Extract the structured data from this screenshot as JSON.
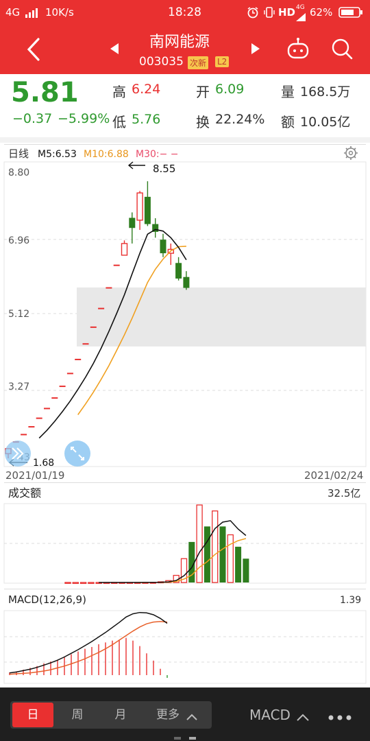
{
  "status": {
    "network": "4G",
    "speed": "10K/s",
    "time": "18:28",
    "hd": "HD",
    "sim_tag": "4G",
    "battery": "62%"
  },
  "header": {
    "stock_name": "南网能源",
    "stock_code": "003035",
    "badge_new": "次新",
    "badge_l2": "L2"
  },
  "quote": {
    "price": "5.81",
    "change": "−0.37",
    "change_pct": "−5.99%",
    "high_label": "高",
    "high": "6.24",
    "low_label": "低",
    "low": "5.76",
    "open_label": "开",
    "open": "6.09",
    "turnover_label": "换",
    "turnover": "22.24%",
    "volume_label": "量",
    "volume": "168.5万",
    "amount_label": "额",
    "amount": "10.05亿"
  },
  "kline": {
    "period": "日线",
    "ma5": "M5:6.53",
    "ma10": "M10:6.88",
    "ma30": "M30:− −",
    "y_ticks": [
      "8.80",
      "6.96",
      "5.12",
      "3.27"
    ],
    "y_bottom": "43",
    "high_mark": "8.55",
    "low_mark": "1.68",
    "date_start": "2021/01/19",
    "date_end": "2021/02/24"
  },
  "volume_panel": {
    "title": "成交额",
    "max": "32.5亿"
  },
  "macd_panel": {
    "title": "MACD(12,26,9)",
    "max": "1.39"
  },
  "bottom": {
    "tabs": [
      "日",
      "周",
      "月",
      "更多"
    ],
    "indicator": "MACD"
  },
  "colors": {
    "up": "#e93030",
    "down": "#2e7d1e",
    "ma10": "#f0a020",
    "ma5": "#111111"
  },
  "chart_data": {
    "type": "candlestick",
    "x_range": [
      "2021/01/19",
      "2021/02/24"
    ],
    "ylim": [
      1.43,
      8.8
    ],
    "highest": 8.55,
    "lowest": 1.68,
    "candles": [
      {
        "o": 1.55,
        "c": 1.68,
        "h": 1.68,
        "l": 1.43
      },
      {
        "o": 1.85,
        "c": 1.85,
        "h": 1.85,
        "l": 1.85
      },
      {
        "o": 2.04,
        "c": 2.04,
        "h": 2.04,
        "l": 2.04
      },
      {
        "o": 2.24,
        "c": 2.24,
        "h": 2.24,
        "l": 2.24
      },
      {
        "o": 2.46,
        "c": 2.46,
        "h": 2.46,
        "l": 2.46
      },
      {
        "o": 2.71,
        "c": 2.71,
        "h": 2.71,
        "l": 2.71
      },
      {
        "o": 2.98,
        "c": 2.98,
        "h": 2.98,
        "l": 2.98
      },
      {
        "o": 3.28,
        "c": 3.28,
        "h": 3.28,
        "l": 3.28
      },
      {
        "o": 3.61,
        "c": 3.61,
        "h": 3.61,
        "l": 3.61
      },
      {
        "o": 3.97,
        "c": 3.97,
        "h": 3.97,
        "l": 3.97
      },
      {
        "o": 4.37,
        "c": 4.37,
        "h": 4.37,
        "l": 4.37
      },
      {
        "o": 4.8,
        "c": 4.8,
        "h": 4.8,
        "l": 4.8
      },
      {
        "o": 5.28,
        "c": 5.28,
        "h": 5.28,
        "l": 5.28
      },
      {
        "o": 5.81,
        "c": 5.81,
        "h": 5.81,
        "l": 5.81
      },
      {
        "o": 6.39,
        "c": 6.39,
        "h": 6.39,
        "l": 6.39
      },
      {
        "o": 6.65,
        "c": 6.95,
        "h": 7.03,
        "l": 6.65
      },
      {
        "o": 7.61,
        "c": 7.35,
        "h": 7.75,
        "l": 6.95
      },
      {
        "o": 7.55,
        "c": 8.25,
        "h": 8.3,
        "l": 7.3
      },
      {
        "o": 8.15,
        "c": 7.45,
        "h": 8.55,
        "l": 7.4
      },
      {
        "o": 7.45,
        "c": 7.25,
        "h": 7.6,
        "l": 7.1
      },
      {
        "o": 7.05,
        "c": 6.7,
        "h": 7.2,
        "l": 6.6
      },
      {
        "o": 6.7,
        "c": 6.8,
        "h": 6.95,
        "l": 6.4
      },
      {
        "o": 6.45,
        "c": 6.05,
        "h": 6.6,
        "l": 6.0
      },
      {
        "o": 6.09,
        "c": 5.81,
        "h": 6.24,
        "l": 5.76
      }
    ],
    "ma5": [
      null,
      null,
      null,
      null,
      1.95,
      2.15,
      2.38,
      2.63,
      2.9,
      3.2,
      3.52,
      3.87,
      4.26,
      4.69,
      5.15,
      5.63,
      6.17,
      6.7,
      7.19,
      7.31,
      7.27,
      7.1,
      6.85,
      6.53
    ],
    "ma10": [
      null,
      null,
      null,
      null,
      null,
      null,
      null,
      null,
      null,
      2.55,
      2.83,
      3.13,
      3.46,
      3.81,
      4.2,
      4.6,
      5.03,
      5.49,
      5.95,
      6.29,
      6.55,
      6.76,
      6.87,
      6.88
    ],
    "amount": [
      0.05,
      0.03,
      0.03,
      0.03,
      0.03,
      0.03,
      0.04,
      0.04,
      0.04,
      0.05,
      0.06,
      0.1,
      0.3,
      0.8,
      3.0,
      10.0,
      17.0,
      32.5,
      23.5,
      30.0,
      23.5,
      20.0,
      15.0,
      10.0
    ],
    "amount_up": [
      true,
      true,
      true,
      true,
      true,
      true,
      true,
      true,
      true,
      true,
      true,
      true,
      true,
      true,
      true,
      true,
      false,
      true,
      false,
      true,
      false,
      true,
      false,
      false
    ],
    "macd_dif": [
      0.05,
      0.07,
      0.1,
      0.13,
      0.17,
      0.22,
      0.27,
      0.33,
      0.4,
      0.48,
      0.56,
      0.65,
      0.74,
      0.84,
      0.94,
      1.05,
      1.16,
      1.28,
      1.35,
      1.38,
      1.37,
      1.33,
      1.25,
      1.14
    ],
    "macd_dea": [
      0.02,
      0.03,
      0.04,
      0.05,
      0.07,
      0.09,
      0.12,
      0.16,
      0.2,
      0.25,
      0.3,
      0.36,
      0.43,
      0.5,
      0.58,
      0.67,
      0.77,
      0.87,
      0.97,
      1.06,
      1.13,
      1.17,
      1.18,
      1.17
    ],
    "macd_bar": [
      0.06,
      0.08,
      0.12,
      0.16,
      0.2,
      0.26,
      0.3,
      0.34,
      0.4,
      0.46,
      0.52,
      0.58,
      0.62,
      0.68,
      0.72,
      0.76,
      0.78,
      0.82,
      0.76,
      0.64,
      0.48,
      0.32,
      0.14,
      -0.06
    ]
  }
}
